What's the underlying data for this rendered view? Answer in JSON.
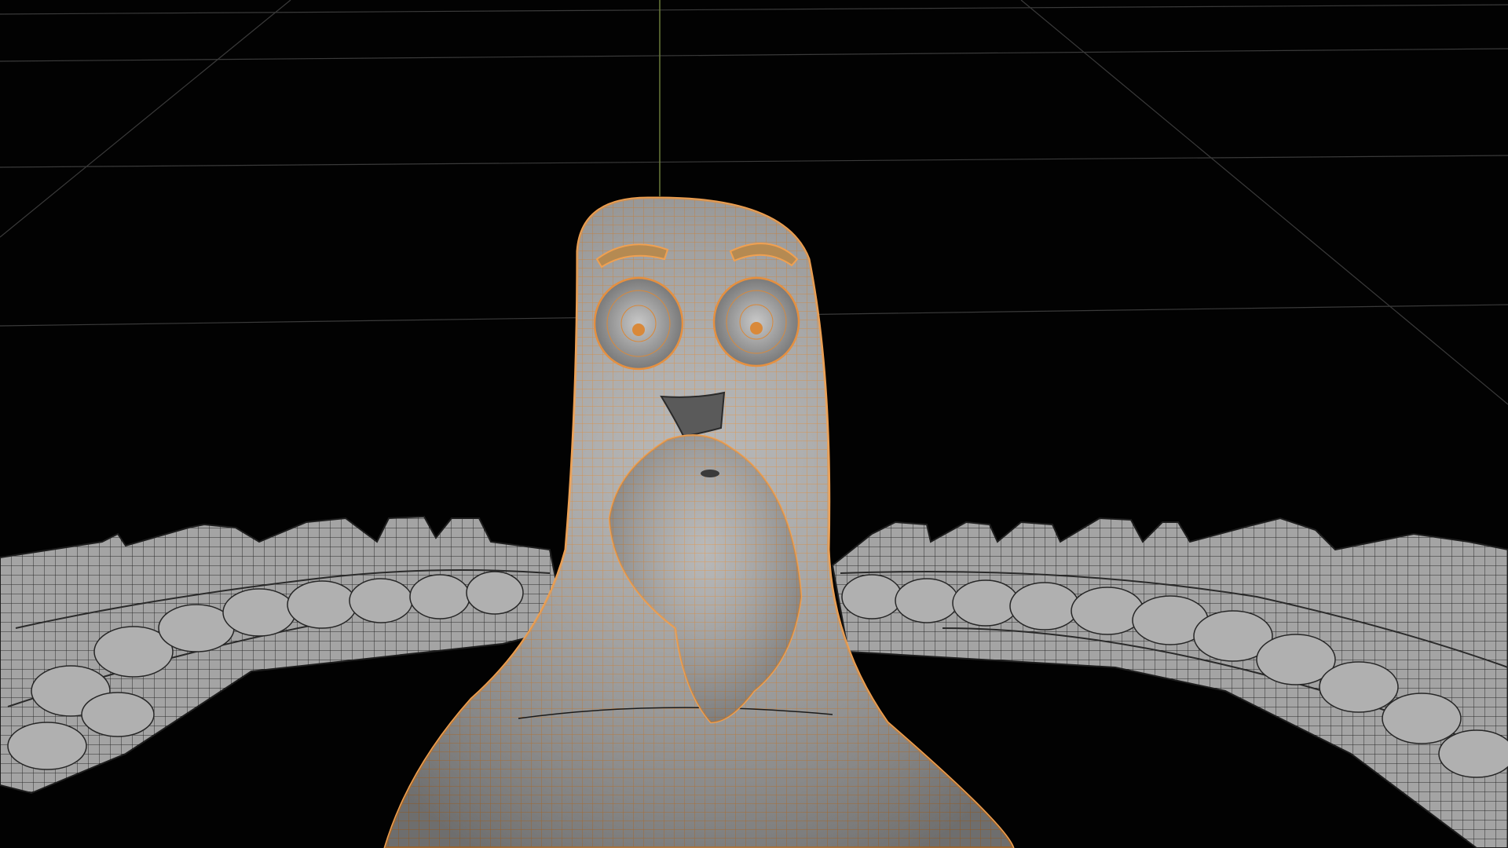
{
  "viewport": {
    "kind": "3d-viewport",
    "shading": "solid-wireframe",
    "object": "bird-character-mesh",
    "selection_outline_color": "#f0a050",
    "wire_color_selected": "#e59040",
    "wire_color_unselected": "#2a2a2a",
    "mesh_color": "#a8a8a8",
    "grid_color": "#3c3c3c",
    "z_axis_color": "#6b7a3a",
    "background_color": "#020202"
  }
}
